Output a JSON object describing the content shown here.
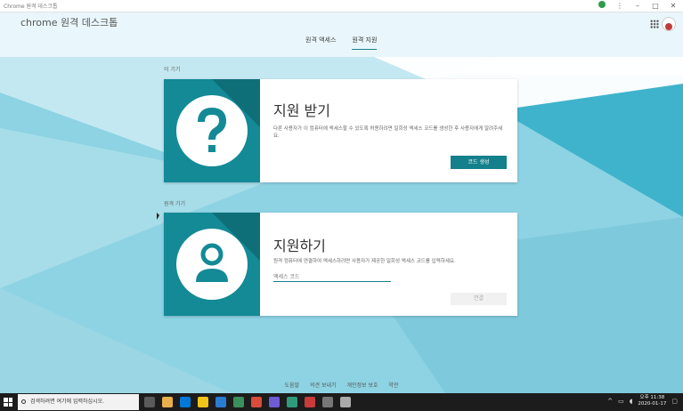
{
  "window": {
    "title": "Chrome 원격 데스크톱"
  },
  "header": {
    "app_title": "chrome 원격 데스크톱",
    "tabs": [
      {
        "label": "원격 액세스",
        "active": false
      },
      {
        "label": "원격 지원",
        "active": true
      }
    ]
  },
  "sections": {
    "receive_label": "이 기기",
    "give_label": "원격 기기"
  },
  "receive_card": {
    "title": "지원 받기",
    "description": "다른 사용자가 이 컴퓨터에 액세스할 수 있도록 허용하려면 일회성 액세스 코드를 생성한 후 사용자에게 알려주세요.",
    "button": "코드 생성"
  },
  "give_card": {
    "title": "지원하기",
    "description": "원격 컴퓨터에 연결하여 액세스하려면 사용자가 제공한 일회성 액세스 코드를 입력하세요.",
    "input_placeholder": "액세스 코드",
    "button": "연결"
  },
  "footer": {
    "links": [
      "도움말",
      "의견 보내기",
      "개인정보 보호",
      "약관"
    ]
  },
  "taskbar": {
    "search_placeholder": "검색하려면 여기에 입력하십시오.",
    "time": "오후 11:38",
    "date": "2020-01-17"
  },
  "colors": {
    "accent": "#14808c",
    "art_bg": "#138a96"
  }
}
